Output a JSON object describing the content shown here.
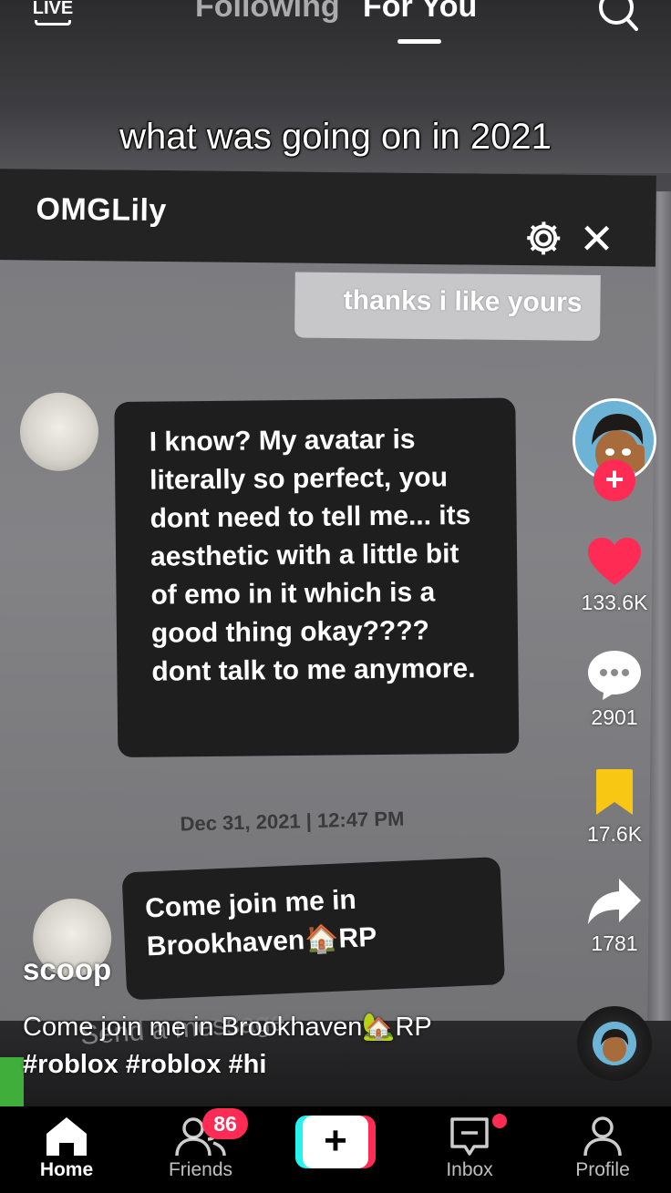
{
  "top_nav": {
    "live_label": "LIVE",
    "tabs": [
      {
        "label": "Following",
        "active": false
      },
      {
        "label": "For You",
        "active": true
      }
    ]
  },
  "video": {
    "caption": "what was going on in 2021",
    "chat": {
      "title": "OMGLily",
      "reply_bubble": "thanks i like yours",
      "message_main": "I know? My avatar is literally so perfect, you dont need to tell me... its aesthetic with a little bit of emo in it which is a good thing okay???? dont talk to me anymore.",
      "timestamp": "Dec 31, 2021 | 12:47 PM",
      "message_second": "Come join me in Brookhaven🏠RP",
      "input_placeholder": "Send a message"
    }
  },
  "actions": {
    "likes": "133.6K",
    "comments": "2901",
    "bookmarks": "17.6K",
    "shares": "1781"
  },
  "post": {
    "username": "scoop",
    "description": "Come join me in Brookhaven🏡RP",
    "hashtags": [
      "#roblox",
      "#roblox",
      "#hi"
    ]
  },
  "tab_bar": {
    "home": "Home",
    "friends": "Friends",
    "friends_badge": "86",
    "create": "+",
    "inbox": "Inbox",
    "profile": "Profile"
  },
  "colors": {
    "accent_red": "#fe2c55",
    "accent_cyan": "#25f4ee",
    "like": "#fe2c55",
    "bookmark": "#f8c714"
  }
}
